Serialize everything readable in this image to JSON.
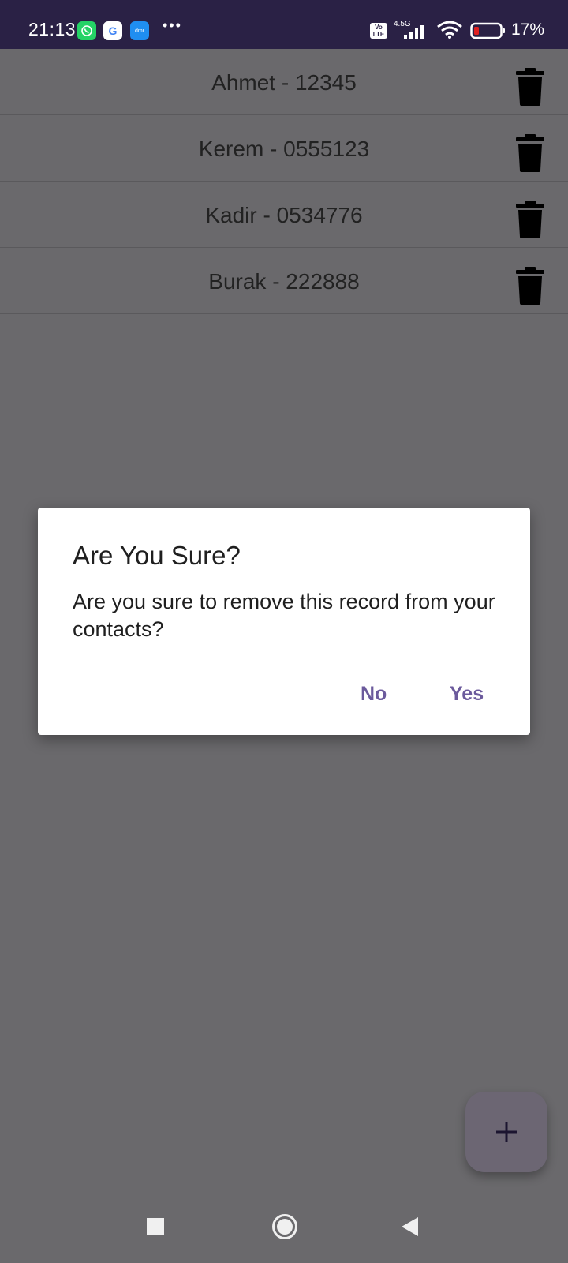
{
  "status_bar": {
    "time": "21:13",
    "network": "4.5G",
    "volte": "Vo\nLTE",
    "battery": "17%",
    "more": "•••",
    "app_icons": [
      "whatsapp-icon",
      "google-icon",
      "dmr-icon"
    ],
    "dmr_label": "dmr"
  },
  "contacts": [
    {
      "label": "Ahmet - 12345"
    },
    {
      "label": "Kerem - 0555123"
    },
    {
      "label": "Kadir - 0534776"
    },
    {
      "label": "Burak - 222888"
    }
  ],
  "dialog": {
    "title": "Are You Sure?",
    "message": "Are you sure to remove this record from your contacts?",
    "no_label": "No",
    "yes_label": "Yes"
  },
  "fab": {
    "icon": "plus-icon"
  },
  "colors": {
    "status_bar_bg": "#2a2145",
    "scrim_bg": "#6a696c",
    "dialog_button": "#6b5a9c",
    "battery_low": "#e02020"
  }
}
